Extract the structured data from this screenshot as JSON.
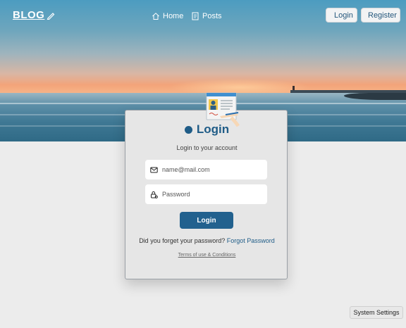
{
  "header": {
    "brand": "BLOG",
    "nav": [
      {
        "label": "Home",
        "icon": "home-icon"
      },
      {
        "label": "Posts",
        "icon": "posts-icon"
      }
    ],
    "login_label": "Login",
    "register_label": "Register"
  },
  "card": {
    "title": "Login",
    "subtitle": "Login to your account",
    "email_placeholder": "name@mail.com",
    "password_placeholder": "Password",
    "submit_label": "Login",
    "forgot_prompt": "Did you forget your password?",
    "forgot_link": "Forgot Password",
    "terms": "Terms of use & Conditions"
  },
  "system_settings_label": "System Settings",
  "colors": {
    "accent": "#22618e",
    "title": "#1f5c87",
    "background": "#ececec"
  }
}
